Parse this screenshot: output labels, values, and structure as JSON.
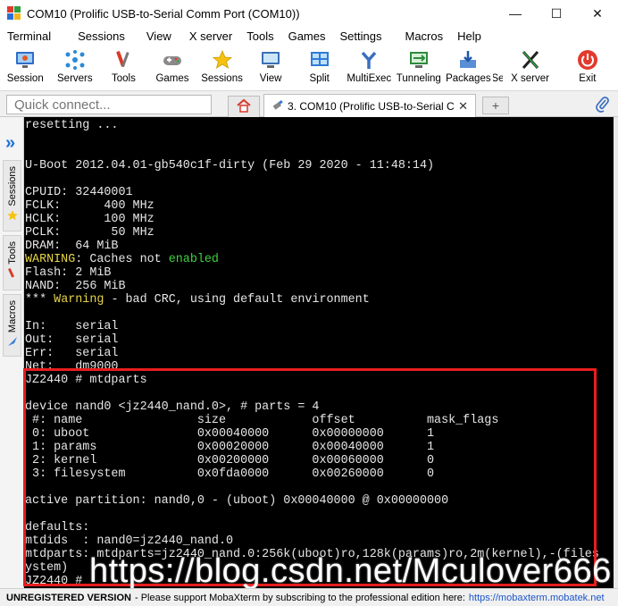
{
  "window": {
    "title": "COM10  (Prolific USB-to-Serial Comm Port (COM10))",
    "minimize": "—",
    "maximize": "☐",
    "close": "✕"
  },
  "menu": [
    "Terminal",
    "Sessions",
    "View",
    "X server",
    "Tools",
    "Games",
    "Settings",
    "Macros",
    "Help"
  ],
  "toolbar": [
    {
      "label": "Session",
      "icon": "session-monitor-icon"
    },
    {
      "label": "Servers",
      "icon": "servers-icon"
    },
    {
      "label": "Tools",
      "icon": "tools-icon"
    },
    {
      "label": "Games",
      "icon": "games-gamepad-icon"
    },
    {
      "label": "Sessions",
      "icon": "star-icon"
    },
    {
      "label": "View",
      "icon": "view-monitor-icon"
    },
    {
      "label": "Split",
      "icon": "split-grid-icon"
    },
    {
      "label": "MultiExec",
      "icon": "multiexec-fork-icon"
    },
    {
      "label": "Tunneling",
      "icon": "tunneling-icon"
    },
    {
      "label": "Packages",
      "icon": "packages-download-icon"
    },
    {
      "label": "Se",
      "icon": "settings-icon"
    },
    {
      "label": "X server",
      "icon": "x-server-icon"
    },
    {
      "label": "Exit",
      "icon": "power-icon"
    }
  ],
  "tabs": {
    "quick_connect_placeholder": "Quick connect...",
    "session_tab_label": "3. COM10 (Prolific USB-to-Serial C",
    "session_tab_close": "✕",
    "new_tab": "+"
  },
  "sidebar": {
    "sessions": "Sessions",
    "tools": "Tools",
    "macros": "Macros"
  },
  "terminal_lines": [
    [
      {
        "t": "resetting ..."
      }
    ],
    [
      {
        "t": ""
      }
    ],
    [
      {
        "t": ""
      }
    ],
    [
      {
        "t": "U-Boot 2012.04.01-gb540c1f-dirty (Feb 29 2020 - 11:48:14)"
      }
    ],
    [
      {
        "t": ""
      }
    ],
    [
      {
        "t": "CPUID: 32440001"
      }
    ],
    [
      {
        "t": "FCLK:      400 MHz"
      }
    ],
    [
      {
        "t": "HCLK:      100 MHz"
      }
    ],
    [
      {
        "t": "PCLK:       50 MHz"
      }
    ],
    [
      {
        "t": "DRAM:  64 MiB"
      }
    ],
    [
      {
        "t": "WARNING",
        "c": "warn"
      },
      {
        "t": ": Caches not "
      },
      {
        "t": "enabled",
        "c": "green"
      }
    ],
    [
      {
        "t": "Flash: 2 MiB"
      }
    ],
    [
      {
        "t": "NAND:  256 MiB"
      }
    ],
    [
      {
        "t": "*** "
      },
      {
        "t": "Warning",
        "c": "warn"
      },
      {
        "t": " - bad CRC, using default environment"
      }
    ],
    [
      {
        "t": ""
      }
    ],
    [
      {
        "t": "In:    serial"
      }
    ],
    [
      {
        "t": "Out:   serial"
      }
    ],
    [
      {
        "t": "Err:   serial"
      }
    ],
    [
      {
        "t": "Net:   dm9000"
      }
    ],
    [
      {
        "t": "JZ2440 # mtdparts"
      }
    ],
    [
      {
        "t": ""
      }
    ],
    [
      {
        "t": "device nand0 <jz2440_nand.0>, # parts = 4"
      }
    ],
    [
      {
        "t": " #: name                size            offset          mask_flags"
      }
    ],
    [
      {
        "t": " 0: uboot               0x00040000      0x00000000      1"
      }
    ],
    [
      {
        "t": " 1: params              0x00020000      0x00040000      1"
      }
    ],
    [
      {
        "t": " 2: kernel              0x00200000      0x00060000      0"
      }
    ],
    [
      {
        "t": " 3: filesystem          0x0fda0000      0x00260000      0"
      }
    ],
    [
      {
        "t": ""
      }
    ],
    [
      {
        "t": "active partition: nand0,0 - (uboot) 0x00040000 @ 0x00000000"
      }
    ],
    [
      {
        "t": ""
      }
    ],
    [
      {
        "t": "defaults:"
      }
    ],
    [
      {
        "t": "mtdids  : nand0=jz2440_nand.0"
      }
    ],
    [
      {
        "t": "mtdparts: mtdparts=jz2440_nand.0:256k(uboot)ro,128k(params)ro,2m(kernel),-(files"
      }
    ],
    [
      {
        "t": "ystem)"
      }
    ],
    [
      {
        "t": "JZ2440 # "
      }
    ]
  ],
  "watermark": "https://blog.csdn.net/Mculover666",
  "status": {
    "unregistered": "UNREGISTERED VERSION",
    "message": " -  Please support MobaXterm by subscribing to the professional edition here:",
    "link": "https://mobaxterm.mobatek.net"
  },
  "colors": {
    "terminal_bg": "#000000",
    "terminal_fg": "#e6e6e6",
    "warning_yellow": "#e8d545",
    "enabled_green": "#3fd13f",
    "highlight_red": "#e81d1d"
  }
}
